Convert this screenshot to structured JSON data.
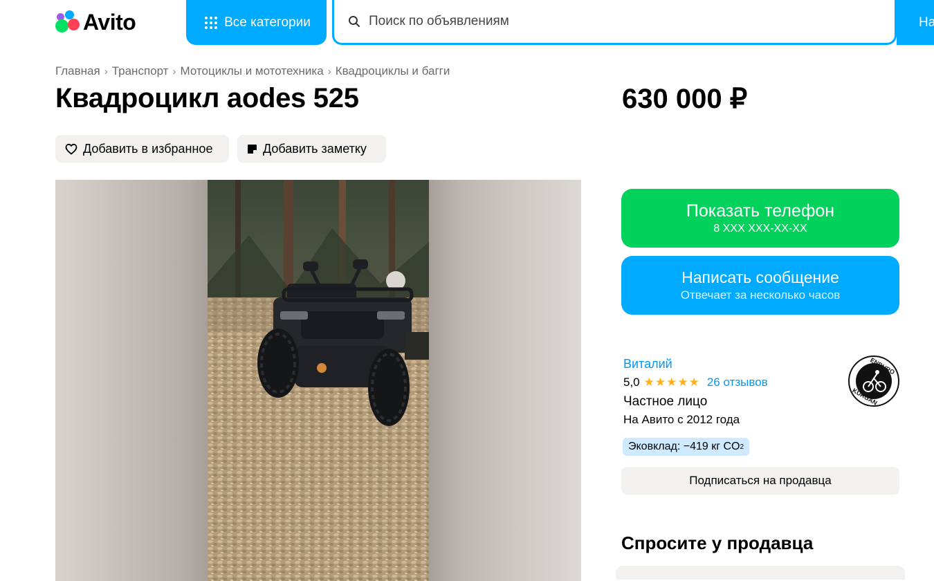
{
  "header": {
    "logo_text": "Avito",
    "categories_label": "Все категории",
    "search_placeholder": "Поиск по объявлениям",
    "find_label": "На"
  },
  "breadcrumb": [
    "Главная",
    "Транспорт",
    "Мотоциклы и мототехника",
    "Квадроциклы и багги"
  ],
  "listing": {
    "title": "Квадроцикл aodes 525",
    "price": "630 000 ₽",
    "favorite_label": "Добавить в избранное",
    "note_label": "Добавить заметку"
  },
  "actions": {
    "phone_label": "Показать телефон",
    "phone_masked": "8 XXX XXX-XX-XX",
    "message_label": "Написать сообщение",
    "message_sub": "Отвечает за несколько часов"
  },
  "seller": {
    "name": "Виталий",
    "rating": "5,0",
    "stars": 5,
    "reviews": "26 отзывов",
    "type": "Частное лицо",
    "since": "На Авито с 2012 года",
    "eco_label": "Эковклад: −419 кг CO",
    "eco_sub": "2",
    "subscribe_label": "Подписаться на продавца",
    "avatar_text_top": "ENDURO",
    "avatar_text_bottom": "KURGAN"
  },
  "ask": {
    "title": "Спросите у продавца"
  },
  "colors": {
    "brand_blue": "#00aaff",
    "green": "#02d15c",
    "chip_bg": "#f2f1f0",
    "link": "#0099f7",
    "star": "#ffb021"
  },
  "icons": {
    "categories": "grid-dots-icon",
    "search": "search-icon",
    "favorite": "heart-icon",
    "note": "note-icon"
  }
}
